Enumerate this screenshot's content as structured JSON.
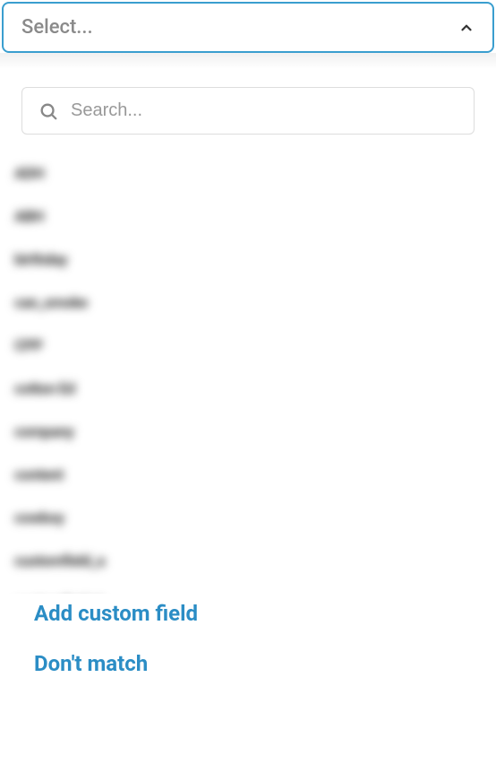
{
  "select": {
    "placeholder": "Select...",
    "open": true
  },
  "search": {
    "placeholder": "Search..."
  },
  "options": [
    "ADH",
    "ABH",
    "birthday",
    "can_smoke",
    "CPP",
    "cotton Ed",
    "company",
    "content",
    "cowboy",
    "customfield_a",
    "customfield_b"
  ],
  "footer": {
    "add_custom_field": "Add custom field",
    "dont_match": "Don't match"
  }
}
